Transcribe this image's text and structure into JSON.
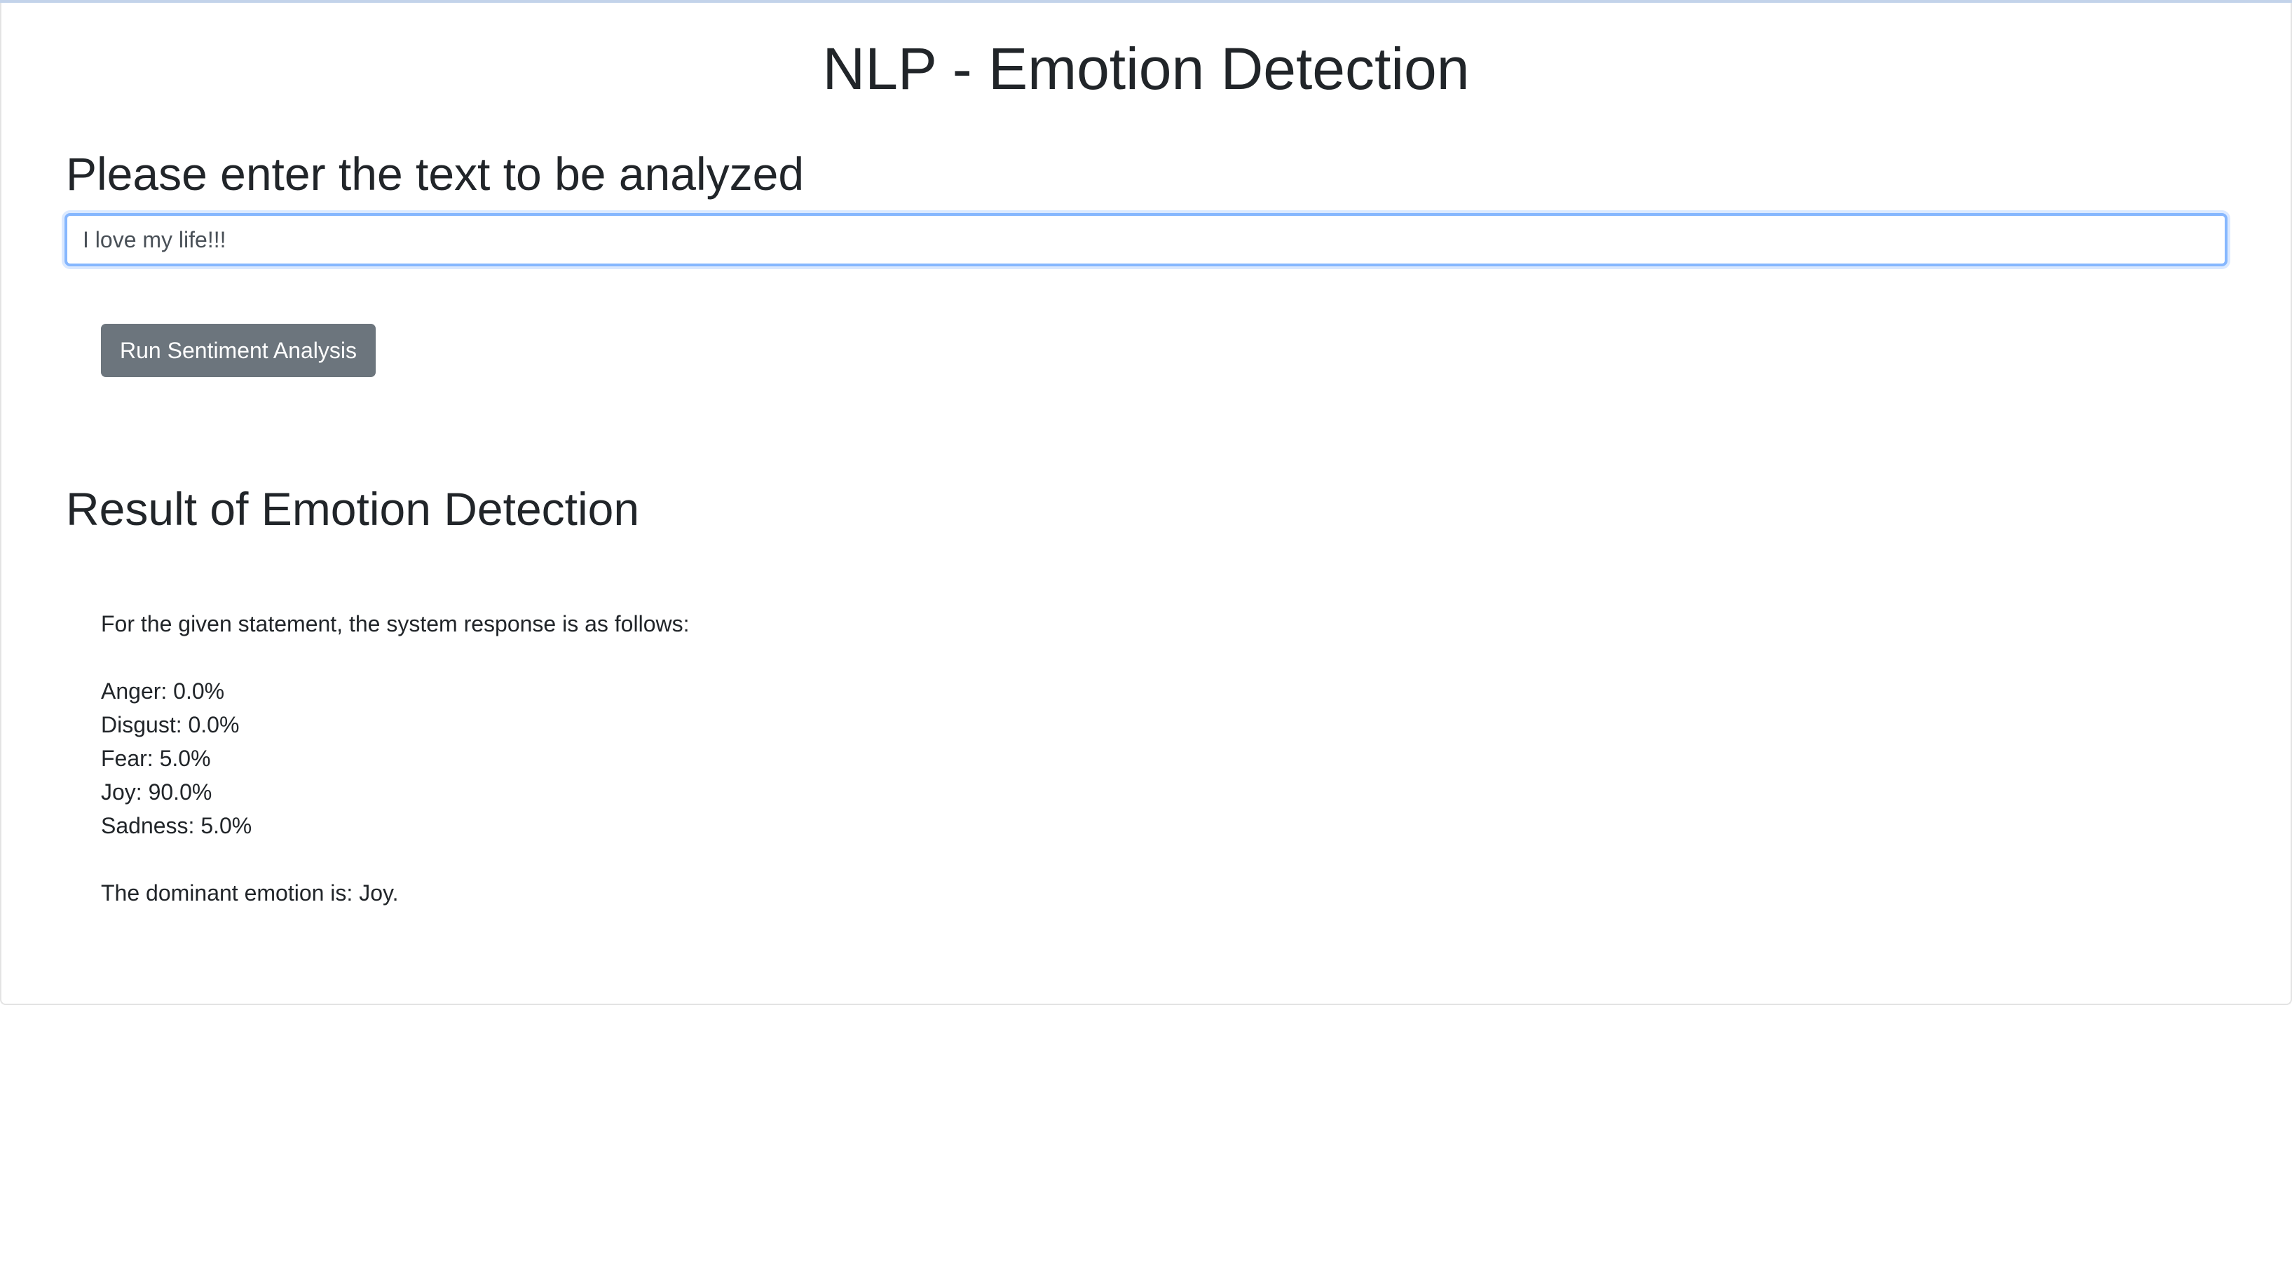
{
  "page": {
    "title": "NLP - Emotion Detection"
  },
  "input_section": {
    "heading": "Please enter the text to be analyzed",
    "value": "I love my life!!!"
  },
  "actions": {
    "run_label": "Run Sentiment Analysis"
  },
  "result_section": {
    "heading": "Result of Emotion Detection",
    "intro": "For the given statement, the system response is as follows:",
    "scores": [
      "Anger: 0.0%",
      "Disgust: 0.0%",
      "Fear: 5.0%",
      "Joy: 90.0%",
      "Sadness: 5.0%"
    ],
    "dominant": "The dominant emotion is: Joy."
  },
  "colors": {
    "button_bg": "#6c757d",
    "input_focus_border": "#86b7fe",
    "text": "#212529"
  }
}
